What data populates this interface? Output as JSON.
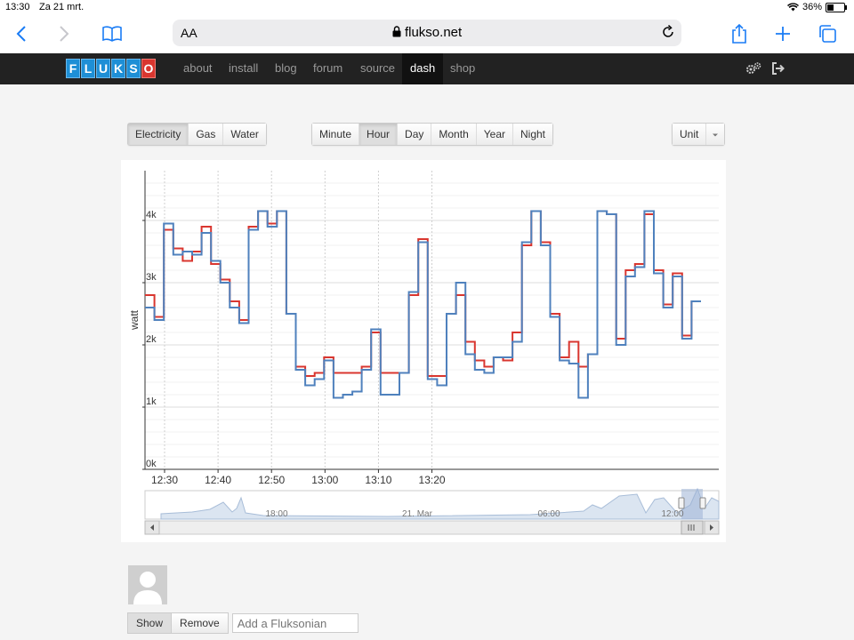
{
  "status": {
    "time": "13:30",
    "date": "Za 21 mrt.",
    "battery": "36%"
  },
  "browser": {
    "aa": "AA",
    "url": "flukso.net"
  },
  "nav": {
    "logo": [
      "F",
      "L",
      "U",
      "K",
      "S",
      "O"
    ],
    "links": [
      "about",
      "install",
      "blog",
      "forum",
      "source",
      "dash",
      "shop"
    ],
    "active": "dash"
  },
  "sources": {
    "items": [
      "Electricity",
      "Gas",
      "Water"
    ],
    "active": "Electricity"
  },
  "intervals": {
    "items": [
      "Minute",
      "Hour",
      "Day",
      "Month",
      "Year",
      "Night"
    ],
    "active": "Hour"
  },
  "unit": {
    "label": "Unit"
  },
  "chart_data": {
    "type": "line",
    "ylabel": "watt",
    "ylim": [
      0,
      4800
    ],
    "yticks": [
      "0k",
      "1k",
      "2k",
      "3k",
      "4k"
    ],
    "xticks": [
      "12:30",
      "12:40",
      "12:50",
      "13:00",
      "13:10",
      "13:20"
    ],
    "colors": {
      "red": "#d9362f",
      "blue": "#4f81bd"
    },
    "series": [
      {
        "color": "red",
        "values": [
          2800,
          2450,
          3850,
          3550,
          3350,
          3500,
          3900,
          3300,
          3050,
          2700,
          2400,
          3900,
          4150,
          3950,
          4150,
          2500,
          1650,
          1500,
          1550,
          1800,
          1550,
          1550,
          1550,
          1650,
          2200,
          1550,
          1550,
          1550,
          2800,
          3700,
          1500,
          1500,
          2500,
          2800,
          2050,
          1750,
          1650,
          1800,
          1750,
          2200,
          3600,
          4150,
          3650,
          2500,
          1800,
          2050,
          1650,
          1850,
          4150,
          4100,
          2100,
          3200,
          3300,
          4100,
          3200,
          2650,
          3150,
          2150,
          2700
        ]
      },
      {
        "color": "blue",
        "values": [
          2600,
          2400,
          3950,
          3450,
          3500,
          3450,
          3800,
          3350,
          3000,
          2600,
          2350,
          3850,
          4150,
          3900,
          4150,
          2500,
          1600,
          1350,
          1450,
          1750,
          1150,
          1200,
          1250,
          1600,
          2250,
          1200,
          1200,
          1550,
          2850,
          3650,
          1450,
          1350,
          2500,
          3000,
          1850,
          1600,
          1550,
          1800,
          1800,
          2050,
          3650,
          4150,
          3600,
          2450,
          1750,
          1700,
          1150,
          1850,
          4150,
          4100,
          2000,
          3100,
          3250,
          4150,
          3150,
          2600,
          3100,
          2100,
          2700
        ]
      }
    ],
    "navigator": {
      "labels": [
        "18:00",
        "21. Mar",
        "06:00",
        "12:00"
      ]
    }
  },
  "profile": {
    "show": "Show",
    "remove": "Remove",
    "placeholder": "Add a Fluksonian"
  }
}
